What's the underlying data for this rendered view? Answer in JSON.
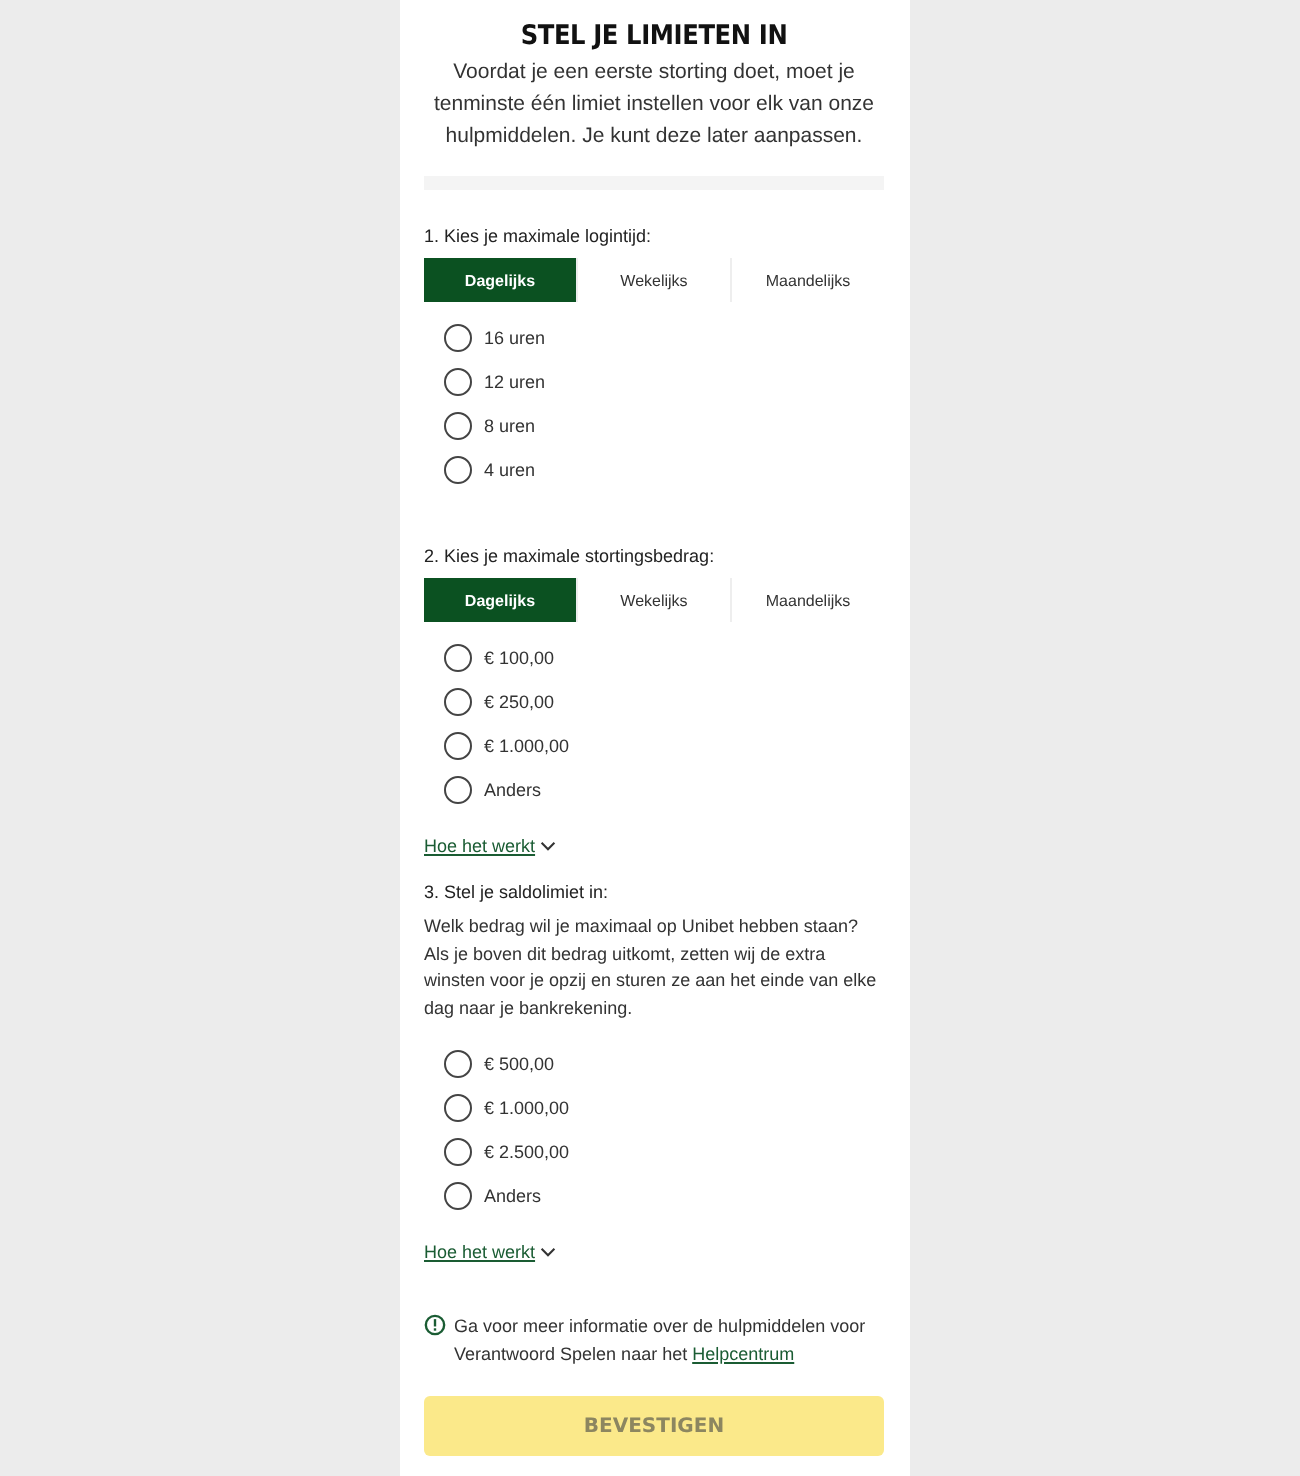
{
  "header": {
    "title": "STEL JE LIMIETEN IN",
    "intro": "Voordat je een eerste storting doet, moet je tenminste één limiet instellen voor elk van onze hulpmiddelen. Je kunt deze later aanpassen."
  },
  "sections": [
    {
      "label": "1. Kies je maximale logintijd:",
      "tabs": [
        {
          "label": "Dagelijks",
          "selected": true
        },
        {
          "label": "Wekelijks",
          "selected": false
        },
        {
          "label": "Maandelijks",
          "selected": false
        }
      ],
      "options": [
        {
          "label": "16 uren",
          "selected": false
        },
        {
          "label": "12 uren",
          "selected": false
        },
        {
          "label": "8 uren",
          "selected": false
        },
        {
          "label": "4 uren",
          "selected": false
        }
      ]
    },
    {
      "label": "2. Kies je maximale stortingsbedrag:",
      "tabs": [
        {
          "label": "Dagelijks",
          "selected": true
        },
        {
          "label": "Wekelijks",
          "selected": false
        },
        {
          "label": "Maandelijks",
          "selected": false
        }
      ],
      "options": [
        {
          "label": "€ 100,00",
          "selected": false
        },
        {
          "label": "€ 250,00",
          "selected": false
        },
        {
          "label": "€ 1.000,00",
          "selected": false
        },
        {
          "label": "Anders",
          "selected": false
        }
      ],
      "link": "Hoe het werkt"
    },
    {
      "label": "3. Stel je saldolimiet in:",
      "description": "Welk bedrag wil je maximaal op Unibet hebben staan? Als je boven dit bedrag uitkomt, zetten wij de extra winsten voor je opzij en sturen ze aan het einde van elke dag naar je bankrekening.",
      "options": [
        {
          "label": "€ 500,00",
          "selected": false
        },
        {
          "label": "€ 1.000,00",
          "selected": false
        },
        {
          "label": "€ 2.500,00",
          "selected": false
        },
        {
          "label": "Anders",
          "selected": false
        }
      ],
      "link": "Hoe het werkt"
    }
  ],
  "info": {
    "text": "Ga voor meer informatie over de hulpmiddelen voor Verantwoord Spelen naar het",
    "link": "Helpcentrum"
  },
  "confirm_button": {
    "label": "BEVESTIGEN",
    "disabled": true
  }
}
